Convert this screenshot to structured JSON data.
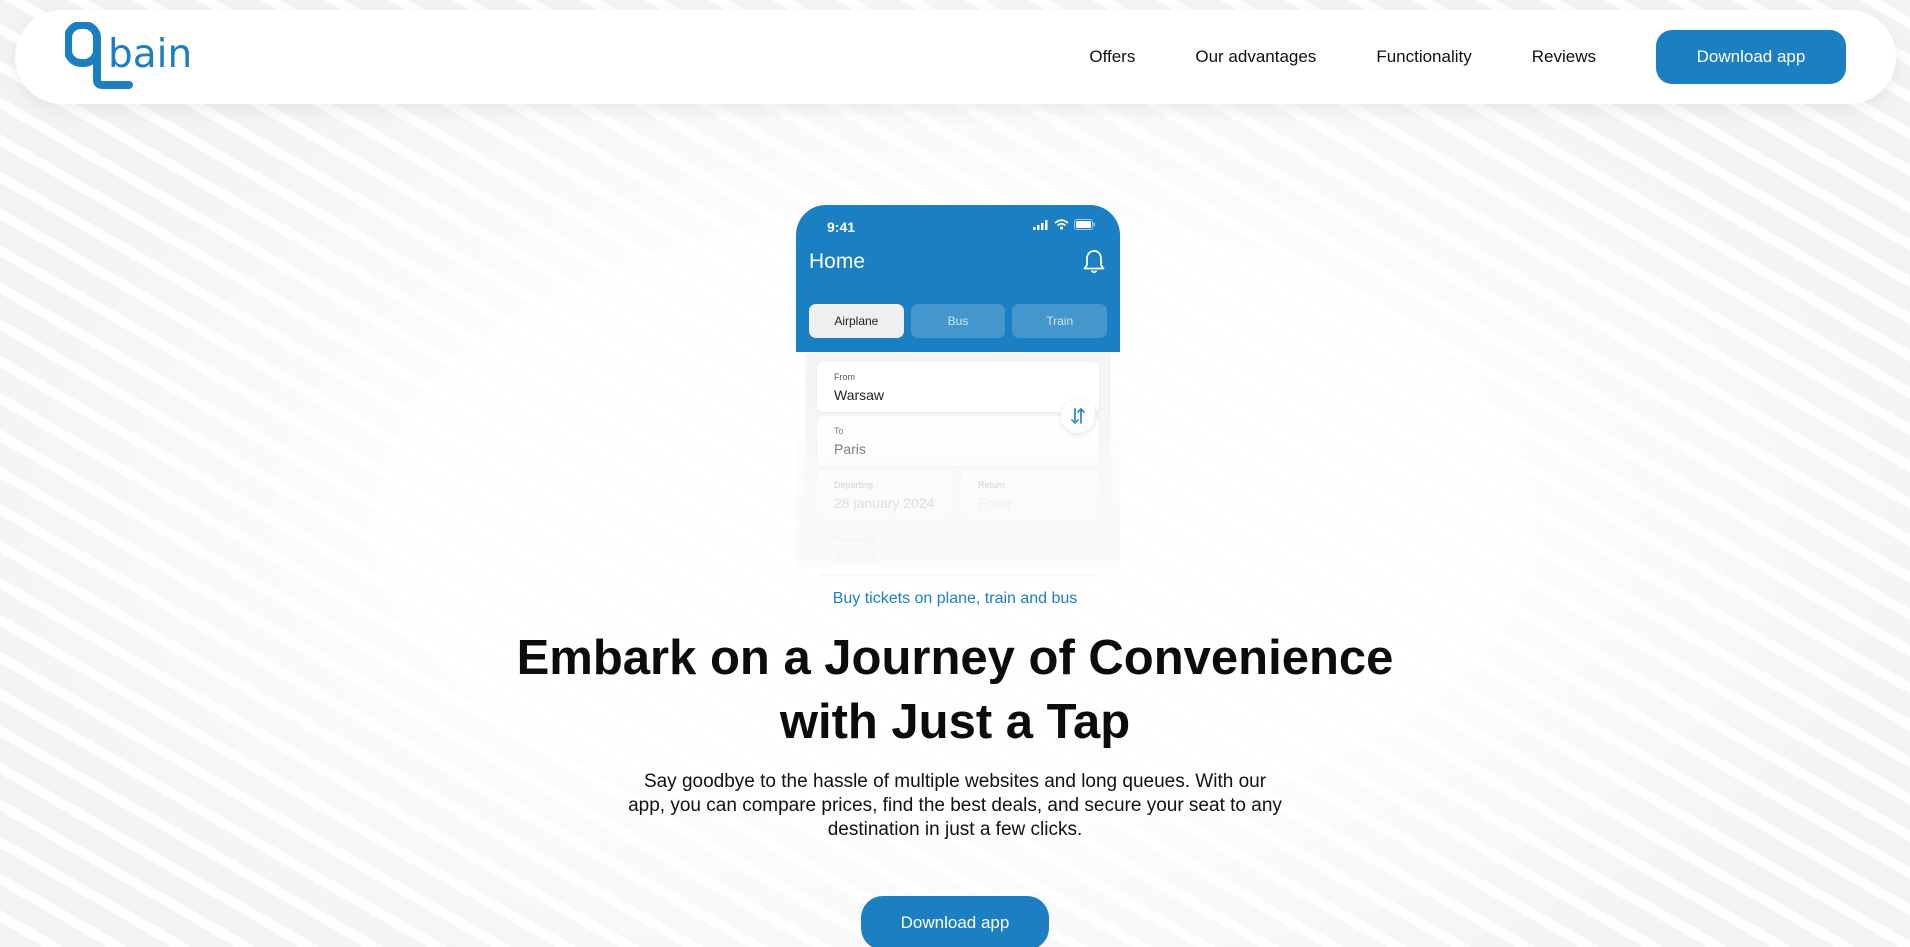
{
  "brand": {
    "logo_text": "bain",
    "logo_icon": "q-logo-icon",
    "accent_color": "#1b7fc2"
  },
  "nav": {
    "items": [
      {
        "label": "Offers"
      },
      {
        "label": "Our advantages"
      },
      {
        "label": "Functionality"
      },
      {
        "label": "Reviews"
      }
    ],
    "cta_label": "Download app"
  },
  "phone": {
    "status_time": "9:41",
    "title": "Home",
    "tabs": [
      {
        "label": "Airplane",
        "active": true
      },
      {
        "label": "Bus",
        "active": false
      },
      {
        "label": "Train",
        "active": false
      }
    ],
    "from": {
      "label": "From",
      "value": "Warsaw"
    },
    "to": {
      "label": "To",
      "value": "Paris"
    },
    "departing": {
      "label": "Departing",
      "value": "28 january 2024"
    },
    "return": {
      "label": "Return",
      "value": "Enter"
    },
    "passenger": {
      "label": "Passenger",
      "value": "Adult 1"
    }
  },
  "hero": {
    "eyebrow": "Buy tickets on plane, train and bus",
    "headline": "Embark on a Journey of Convenience with Just a Tap",
    "subtext": "Say goodbye to the hassle of multiple websites and long queues. With our app, you can compare prices, find the best deals, and secure your seat to any destination in just a few clicks.",
    "cta_label": "Download app"
  }
}
